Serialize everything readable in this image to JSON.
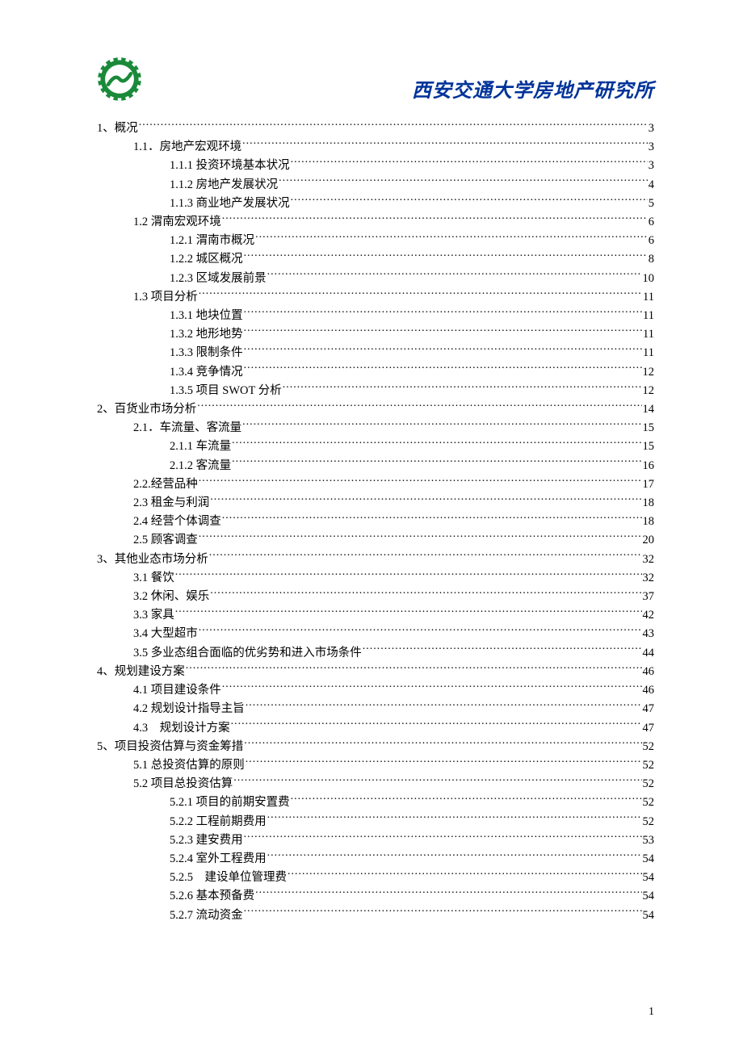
{
  "header": {
    "title": "西安交通大学房地产研究所"
  },
  "toc": [
    {
      "level": 0,
      "label": "1、概况",
      "page": "3"
    },
    {
      "level": 1,
      "label": "1.1．房地产宏观环境",
      "page": "3"
    },
    {
      "level": 2,
      "label": "1.1.1 投资环境基本状况",
      "page": "3"
    },
    {
      "level": 2,
      "label": "1.1.2 房地产发展状况",
      "page": "4"
    },
    {
      "level": 2,
      "label": "1.1.3 商业地产发展状况",
      "page": "5"
    },
    {
      "level": 1,
      "label": "1.2 渭南宏观环境",
      "page": "6"
    },
    {
      "level": 2,
      "label": "1.2.1 渭南市概况",
      "page": "6"
    },
    {
      "level": 2,
      "label": "1.2.2 城区概况",
      "page": "8"
    },
    {
      "level": 2,
      "label": "1.2.3 区域发展前景",
      "page": "10"
    },
    {
      "level": 1,
      "label": "1.3 项目分析",
      "page": "11"
    },
    {
      "level": 2,
      "label": "1.3.1 地块位置",
      "page": "11"
    },
    {
      "level": 2,
      "label": "1.3.2 地形地势",
      "page": "11"
    },
    {
      "level": 2,
      "label": "1.3.3 限制条件",
      "page": "11"
    },
    {
      "level": 2,
      "label": "1.3.4 竞争情况",
      "page": "12"
    },
    {
      "level": 2,
      "label": "1.3.5 项目 SWOT 分析",
      "page": "12"
    },
    {
      "level": 0,
      "label": "2、百货业市场分析",
      "page": "14"
    },
    {
      "level": 1,
      "label": "2.1．车流量、客流量",
      "page": "15"
    },
    {
      "level": 2,
      "label": "2.1.1 车流量",
      "page": "15"
    },
    {
      "level": 2,
      "label": "2.1.2 客流量",
      "page": "16"
    },
    {
      "level": 1,
      "label": "2.2.经营品种",
      "page": "17"
    },
    {
      "level": 1,
      "label": "2.3 租金与利润",
      "page": "18"
    },
    {
      "level": 1,
      "label": "2.4 经营个体调查",
      "page": "18"
    },
    {
      "level": 1,
      "label": "2.5 顾客调查",
      "page": "20"
    },
    {
      "level": 0,
      "label": "3、其他业态市场分析",
      "page": "32"
    },
    {
      "level": 1,
      "label": "3.1 餐饮",
      "page": "32"
    },
    {
      "level": 1,
      "label": "3.2 休闲、娱乐",
      "page": "37"
    },
    {
      "level": 1,
      "label": "3.3 家具",
      "page": "42"
    },
    {
      "level": 1,
      "label": "3.4 大型超市",
      "page": "43"
    },
    {
      "level": 1,
      "label": "3.5 多业态组合面临的优劣势和进入市场条件",
      "page": "44"
    },
    {
      "level": 0,
      "label": "4、规划建设方案",
      "page": "46"
    },
    {
      "level": 1,
      "label": "4.1 项目建设条件",
      "page": "46"
    },
    {
      "level": 1,
      "label": "4.2 规划设计指导主旨",
      "page": "47"
    },
    {
      "level": 1,
      "label": "4.3　规划设计方案",
      "page": "47"
    },
    {
      "level": 0,
      "label": "5、项目投资估算与资金筹措",
      "page": "52"
    },
    {
      "level": 1,
      "label": "5.1 总投资估算的原则",
      "page": "52"
    },
    {
      "level": 1,
      "label": "5.2 项目总投资估算",
      "page": "52"
    },
    {
      "level": 2,
      "label": "5.2.1 项目的前期安置费",
      "page": "52"
    },
    {
      "level": 2,
      "label": "5.2.2 工程前期费用",
      "page": "52"
    },
    {
      "level": 2,
      "label": "5.2.3 建安费用",
      "page": "53"
    },
    {
      "level": 2,
      "label": "5.2.4 室外工程费用",
      "page": "54"
    },
    {
      "level": 2,
      "label": "5.2.5　建设单位管理费",
      "page": "54"
    },
    {
      "level": 2,
      "label": "5.2.6 基本预备费",
      "page": "54"
    },
    {
      "level": 2,
      "label": "5.2.7 流动资金",
      "page": "54"
    }
  ],
  "footer": {
    "page_number": "1"
  }
}
